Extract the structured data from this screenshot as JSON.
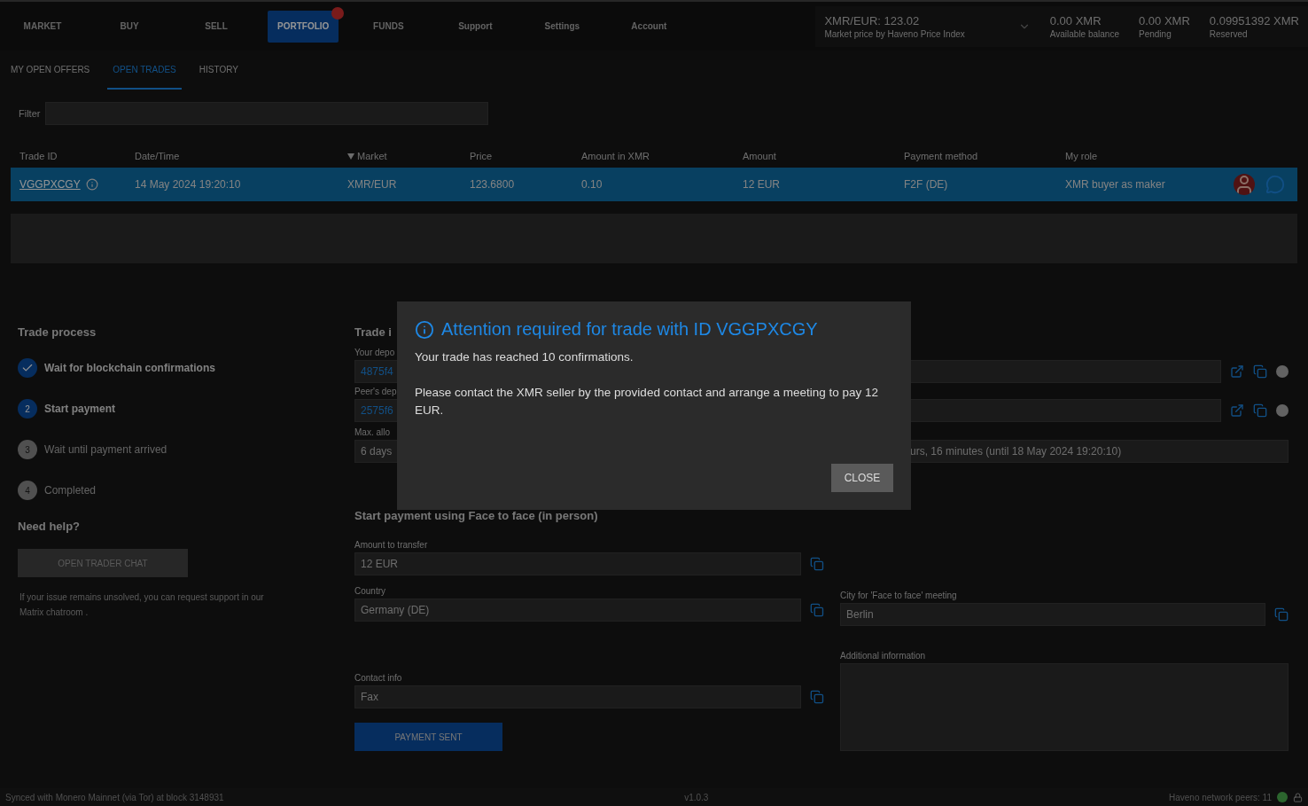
{
  "nav": [
    {
      "label": "MARKET",
      "selected": false,
      "badge": false
    },
    {
      "label": "BUY",
      "selected": false,
      "badge": false
    },
    {
      "label": "SELL",
      "selected": false,
      "badge": false
    },
    {
      "label": "PORTFOLIO",
      "selected": true,
      "badge": true
    },
    {
      "label": "FUNDS",
      "selected": false,
      "badge": false
    },
    {
      "label": "Support",
      "selected": false,
      "badge": false
    },
    {
      "label": "Settings",
      "selected": false,
      "badge": false
    },
    {
      "label": "Account",
      "selected": false,
      "badge": false
    }
  ],
  "market": {
    "price": "XMR/EUR: 123.02",
    "caption": "Market price by Haveno Price Index"
  },
  "balances": [
    {
      "value": "0.00 XMR",
      "caption": "Available balance"
    },
    {
      "value": "0.00 XMR",
      "caption": "Pending"
    },
    {
      "value": "0.09951392 XMR",
      "caption": "Reserved"
    }
  ],
  "subtabs": [
    {
      "label": "MY OPEN OFFERS",
      "selected": false
    },
    {
      "label": "OPEN TRADES",
      "selected": true
    },
    {
      "label": "HISTORY",
      "selected": false
    }
  ],
  "filter": {
    "label": "Filter"
  },
  "table": {
    "columns": [
      {
        "label": "Trade ID",
        "sorted": false
      },
      {
        "label": "Date/Time",
        "sorted": false
      },
      {
        "label": "Market",
        "sorted": true
      },
      {
        "label": "Price",
        "sorted": false
      },
      {
        "label": "Amount in XMR",
        "sorted": false
      },
      {
        "label": "Amount",
        "sorted": false
      },
      {
        "label": "Payment method",
        "sorted": false
      },
      {
        "label": "My role",
        "sorted": false
      }
    ],
    "rows": [
      {
        "selected": true,
        "cells": [
          "VGGPXCGY",
          "14 May 2024 19:20:10",
          "XMR/EUR",
          "123.6800",
          "0.10",
          "12 EUR",
          "F2F (DE)",
          "XMR buyer as maker"
        ]
      }
    ]
  },
  "trade_process": {
    "title": "Trade process",
    "steps": [
      {
        "label": "Wait for blockchain confirmations",
        "done": true,
        "active": false
      },
      {
        "label": "Start payment",
        "done": false,
        "active": true,
        "number": "2"
      },
      {
        "label": "Wait until payment arrived",
        "done": false,
        "active": false,
        "number": "3"
      },
      {
        "label": "Completed",
        "done": false,
        "active": false,
        "number": "4"
      }
    ]
  },
  "help": {
    "title": "Need help?",
    "button": "OPEN TRADER CHAT",
    "text": "If your issue remains unsolved, you can request support in our",
    "link": "Matrix chatroom",
    "after": "."
  },
  "trade_info": {
    "title": "Trade i",
    "fields": [
      {
        "label": "Your depo",
        "value": "4875f4"
      },
      {
        "label": "Peer's dep",
        "value": "2575f6"
      }
    ],
    "period": {
      "label": "Max. allo",
      "value_start": "6 days",
      "value_end": "urs, 16 minutes (until 18 May 2024 19:20:10)"
    }
  },
  "payment": {
    "title": "Start payment using Face to face (in person)",
    "left": [
      {
        "label": "Amount to transfer",
        "value": "12 EUR"
      },
      {
        "label": "Country",
        "value": "Germany (DE)"
      },
      {
        "label": "Contact info",
        "value": "Fax"
      }
    ],
    "city": {
      "label": "City for 'Face to face' meeting",
      "value": "Berlin"
    },
    "additional": {
      "label": "Additional information"
    },
    "button": "PAYMENT SENT"
  },
  "status": {
    "sync": "Synced with Monero Mainnet (via Tor) at block 3148931",
    "version": "v1.0.3",
    "peers": "Haveno network peers: 11"
  },
  "dialog": {
    "title": "Attention required for trade with ID VGGPXCGY",
    "lines": [
      "Your trade has reached 10 confirmations.",
      "Please contact the XMR seller by the provided contact and arrange a meeting to pay 12 EUR."
    ],
    "button": "CLOSE"
  }
}
